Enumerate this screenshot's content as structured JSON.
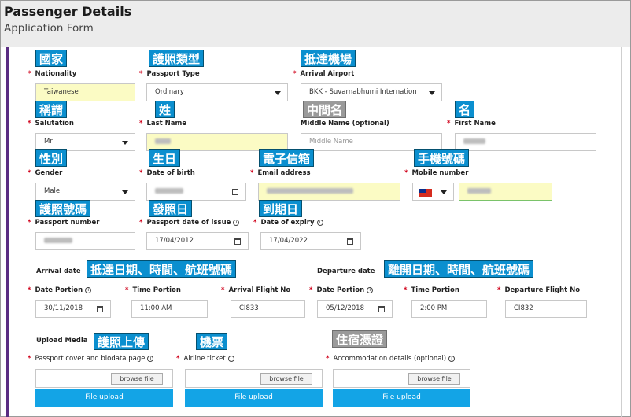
{
  "header": {
    "title": "Passenger Details",
    "subtitle": "Application Form"
  },
  "tags": {
    "nationality": "國家",
    "passport_type": "護照類型",
    "arrival_airport": "抵達機場",
    "salutation": "稱謂",
    "last_name": "姓",
    "middle_name": "中間名",
    "first_name": "名",
    "gender": "性別",
    "dob": "生日",
    "email": "電子信箱",
    "mobile": "手機號碼",
    "passport_number": "護照號碼",
    "issue_date": "發照日",
    "expiry_date": "到期日",
    "arrival_info": "抵達日期、時間、航班號碼",
    "departure_info": "離開日期、時間、航班號碼",
    "passport_upload": "護照上傳",
    "airline_ticket": "機票",
    "accommodation": "住宿憑證"
  },
  "labels": {
    "nationality": "Nationality",
    "passport_type": "Passport Type",
    "arrival_airport": "Arrival Airport",
    "salutation": "Salutation",
    "last_name": "Last Name",
    "middle_name": "Middle Name (optional)",
    "first_name": "First Name",
    "gender": "Gender",
    "dob": "Date of birth",
    "email": "Email address",
    "mobile": "Mobile number",
    "passport_number": "Passport number",
    "issue_date": "Passport date of issue",
    "expiry_date": "Date of expiry",
    "arrival_date": "Arrival date",
    "departure_date": "Departure date",
    "date_portion": "Date Portion",
    "time_portion": "Time Portion",
    "arrival_flight": "Arrival Flight No",
    "departure_flight": "Departure Flight No",
    "upload_media": "Upload Media",
    "passport_cover": "Passport cover and biodata page",
    "airline_ticket": "Airline ticket",
    "accommodation": "Accommodation details (optional)"
  },
  "values": {
    "nationality": "Taiwanese",
    "passport_type": "Ordinary",
    "arrival_airport": "BKK - Suvarnabhumi Internation",
    "salutation": "Mr",
    "middle_name_placeholder": "Middle Name",
    "gender": "Male",
    "issue_date": "17/04/2012",
    "expiry_date": "17/04/2022",
    "arrival_date": "30/11/2018",
    "arrival_time": "11:00 AM",
    "arrival_flight": "CI833",
    "departure_date": "05/12/2018",
    "departure_time": "2:00 PM",
    "departure_flight": "CI832"
  },
  "uploads": {
    "browse_label": "browse file",
    "upload_label": "File upload"
  },
  "colors": {
    "tag_blue": "#0b8fcf",
    "tag_gray": "#9a9a9a",
    "upload_button": "#13a4e6",
    "highlight_yellow": "#fbfbc4",
    "required_red": "#d0021b"
  }
}
